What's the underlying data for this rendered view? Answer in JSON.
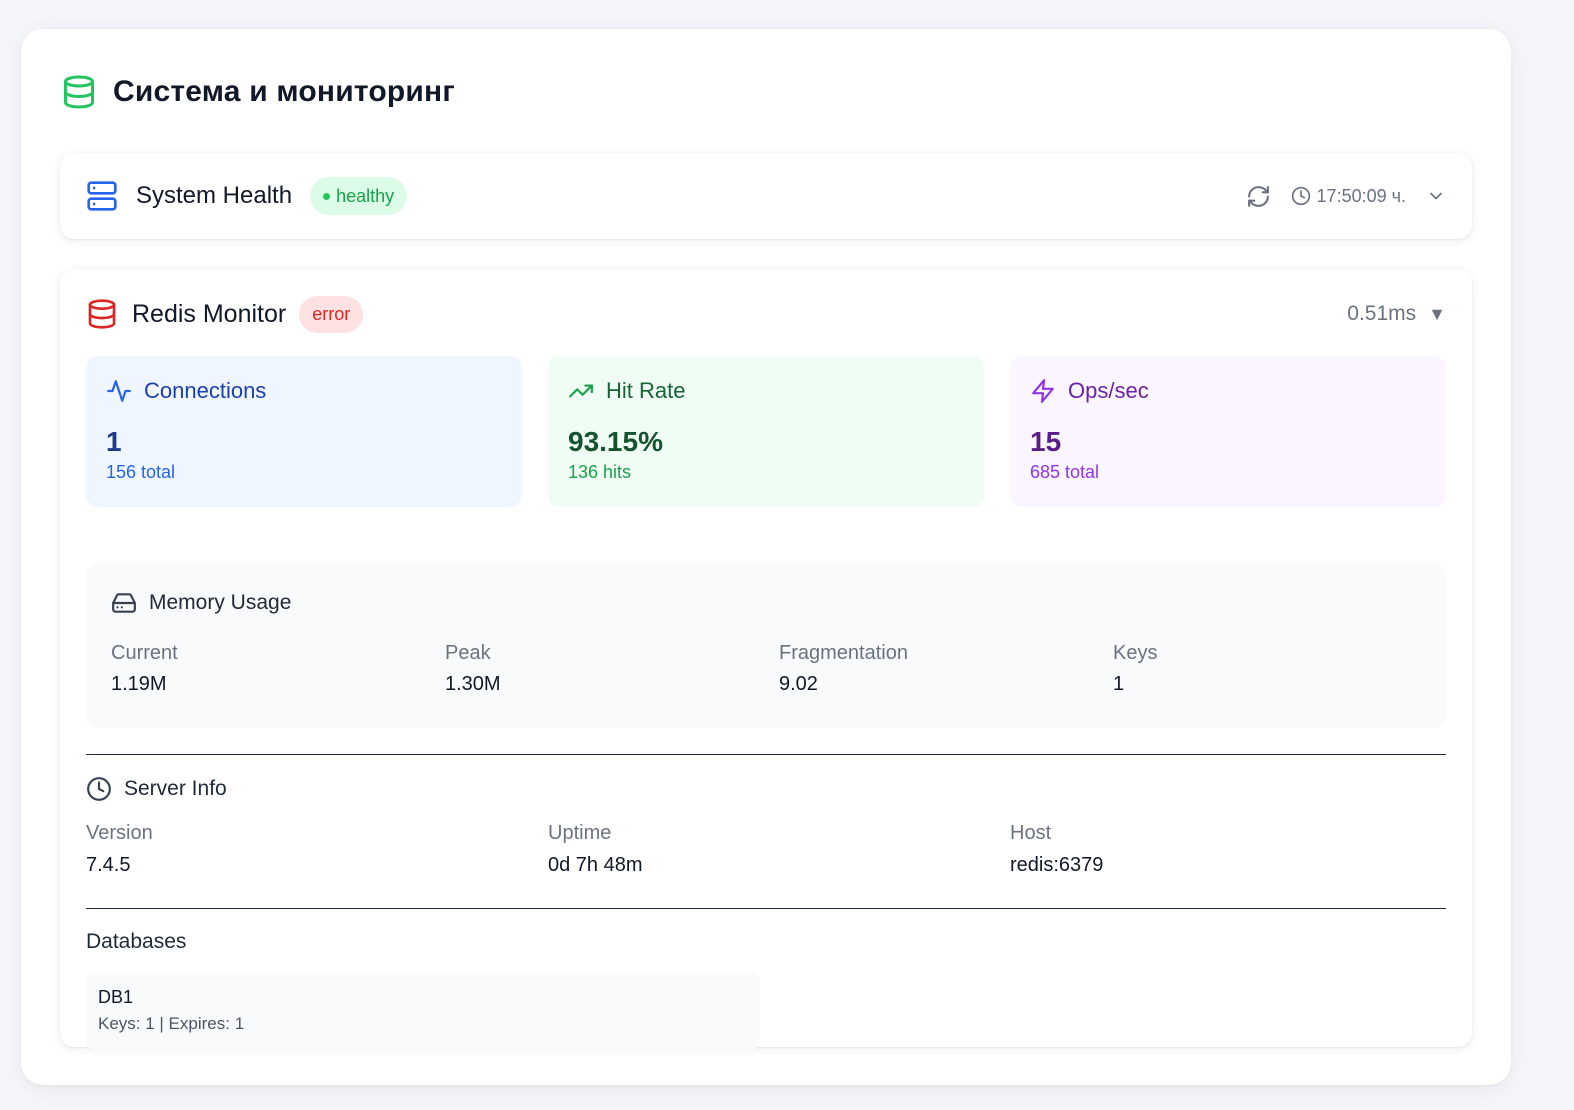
{
  "page": {
    "title": "Система и мониторинг",
    "title_icon": "database-icon",
    "title_icon_color": "#22c55e"
  },
  "system_health": {
    "title": "System Health",
    "icon": "server-icon",
    "icon_color": "#2563eb",
    "status": "healthy",
    "status_color": "#16a34a",
    "time": "17:50:09 ч.",
    "refresh_icon": "refresh-icon",
    "clock_icon": "clock-icon",
    "expand_icon": "chevron-down-icon"
  },
  "redis": {
    "title": "Redis Monitor",
    "icon": "database-icon",
    "icon_color": "#dc2626",
    "status": "error",
    "status_color": "#dc2626",
    "latency": "0.51ms",
    "toggle_glyph": "▼",
    "stats": [
      {
        "label": "Connections",
        "icon": "activity-icon",
        "value": "1",
        "sub": "156 total",
        "color": "#2563eb"
      },
      {
        "label": "Hit Rate",
        "icon": "trending-up-icon",
        "value": "93.15%",
        "sub": "136 hits",
        "color": "#16a34a"
      },
      {
        "label": "Ops/sec",
        "icon": "zap-icon",
        "value": "15",
        "sub": "685 total",
        "color": "#9333ea"
      }
    ],
    "memory": {
      "title": "Memory Usage",
      "icon": "hard-drive-icon",
      "metrics": [
        {
          "label": "Current",
          "value": "1.19M"
        },
        {
          "label": "Peak",
          "value": "1.30M"
        },
        {
          "label": "Fragmentation",
          "value": "9.02"
        },
        {
          "label": "Keys",
          "value": "1"
        }
      ]
    },
    "server_info": {
      "title": "Server Info",
      "icon": "clock-icon",
      "fields": [
        {
          "label": "Version",
          "value": "7.4.5"
        },
        {
          "label": "Uptime",
          "value": "0d 7h 48m"
        },
        {
          "label": "Host",
          "value": "redis:6379"
        }
      ]
    },
    "databases": {
      "title": "Databases",
      "items": [
        {
          "name": "DB1",
          "meta": "Keys: 1 | Expires: 1"
        }
      ]
    }
  }
}
